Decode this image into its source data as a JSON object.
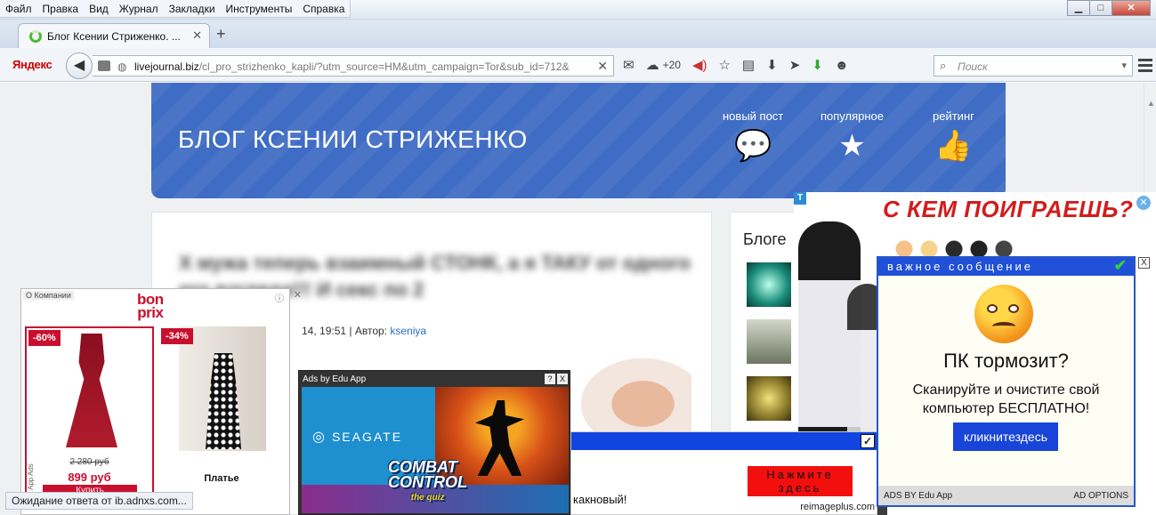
{
  "menubar": {
    "items": [
      "Файл",
      "Правка",
      "Вид",
      "Журнал",
      "Закладки",
      "Инструменты",
      "Справка"
    ]
  },
  "window_controls": {
    "minimize": "▁",
    "maximize": "□",
    "close": "✕"
  },
  "tab": {
    "title": "Блог Ксении Стриженко. ...",
    "close": "✕",
    "new_tab": "+"
  },
  "toolbar": {
    "yandex_label": "Яндекс",
    "back_icon": "back-arrow-icon",
    "url_host": "livejournal.biz",
    "url_path": "/cl_pro_strizhenko_kapli/?utm_source=HM&utm_campaign=Tor&sub_id=712&",
    "clear": "✕",
    "weather_count": "+20",
    "search_placeholder": "Поиск"
  },
  "page": {
    "blog_title": "БЛОГ КСЕНИИ СТРИЖЕНКО",
    "nav": [
      {
        "label": "новый пост",
        "icon": "chat-bubbles-icon"
      },
      {
        "label": "популярное",
        "icon": "star-icon"
      },
      {
        "label": "рейтинг",
        "icon": "thumbs-up-icon"
      }
    ],
    "article": {
      "headline": "Х мужа теперь взаимный СТОНК, а я ТАКУ от одного его взгляда!!! И секс по 2",
      "date": "14, 19:51",
      "author_prefix": "| Автор:",
      "author": "kseniya"
    },
    "sidebar_heading": "Блоге"
  },
  "ads": {
    "anime": {
      "headline": "С КЕМ ПОИГРАЕШЬ?",
      "badge": "T",
      "close": "✕"
    },
    "pc": {
      "bar": "важное сообщение",
      "question": "ПК тормозит?",
      "text_line1": "Сканируйте и очистите свой",
      "text_line2": "компьютер БЕСПЛАТНО!",
      "button": "кликнитездесь",
      "footer_left": "ADS BY Edu App",
      "footer_right": "AD OPTIONS",
      "close": "X"
    },
    "bonprix": {
      "company": "О Компании",
      "logo_line1": "bon",
      "logo_line2": "prix",
      "info": "ⓘ",
      "close": "✕",
      "vertical": "App Ads",
      "products": [
        {
          "discount": "-60%",
          "old_price": "2 280 руб",
          "price": "899 руб",
          "button": "Купить"
        },
        {
          "discount": "-34%",
          "name": "Платье"
        }
      ]
    },
    "edu": {
      "title": "Ads by Edu App",
      "help": "?",
      "close": "X",
      "seagate": "SEAGATE",
      "game_line1": "COMBAT",
      "game_line2": "CONTROL",
      "game_sub": "the quiz"
    },
    "reimage": {
      "checkbox": "✓",
      "button_line1": "Нажмите",
      "button_line2": "здесь",
      "tail_text": "какновый!",
      "domain": "reimageplus.com"
    }
  },
  "status_text": "Ожидание ответа от ib.adnxs.com..."
}
